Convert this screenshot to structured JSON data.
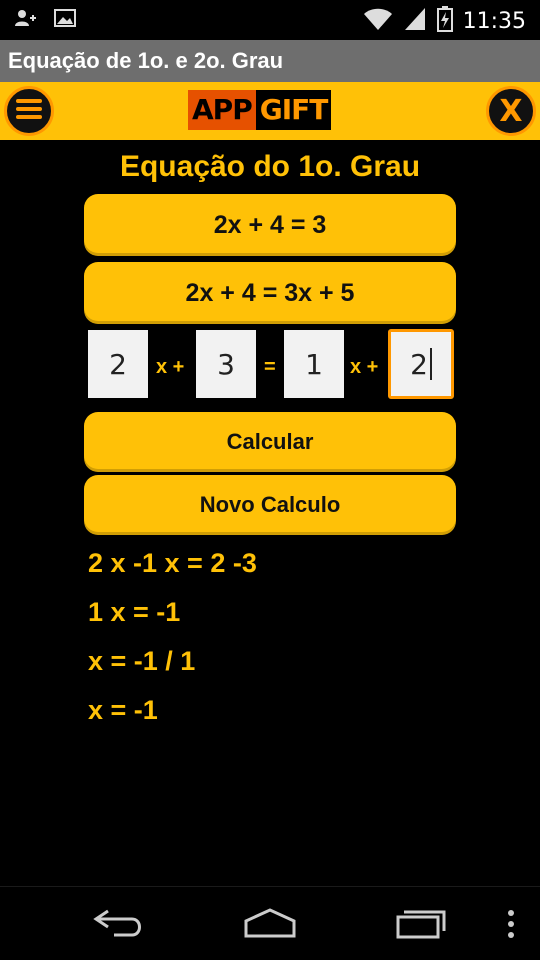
{
  "status_bar": {
    "time": "11:35",
    "icons": [
      "user-add-icon",
      "image-icon",
      "wifi-icon",
      "signal-icon",
      "battery-icon"
    ]
  },
  "title_bar": {
    "title": "Equação de 1o. e 2o. Grau"
  },
  "header": {
    "logo_part1": "APP",
    "logo_part2": "GIFT",
    "menu_icon": "hamburger-menu-icon",
    "close_label": "X"
  },
  "main": {
    "section_title": "Equação do 1o. Grau",
    "equation_buttons": [
      "2x + 4 = 3",
      "2x + 4 = 3x + 5"
    ],
    "inputs": {
      "a": "2",
      "op1": "x +",
      "b": "3",
      "eq": "=",
      "c": "1",
      "op2": "x +",
      "d": "2"
    },
    "calculate_label": "Calcular",
    "new_calc_label": "Novo Calculo",
    "result_lines": [
      "2 x  -1 x = 2  -3",
      "1 x = -1",
      "x = -1 / 1",
      "x = -1"
    ]
  },
  "colors": {
    "accent": "#ffc107",
    "logo_orange": "#e65100",
    "focus_border": "#ff9800",
    "title_bar": "#6e6e6e",
    "background": "#000000"
  },
  "nav_bar": {
    "icons": [
      "back-icon",
      "home-icon",
      "recents-icon",
      "overflow-icon"
    ]
  }
}
